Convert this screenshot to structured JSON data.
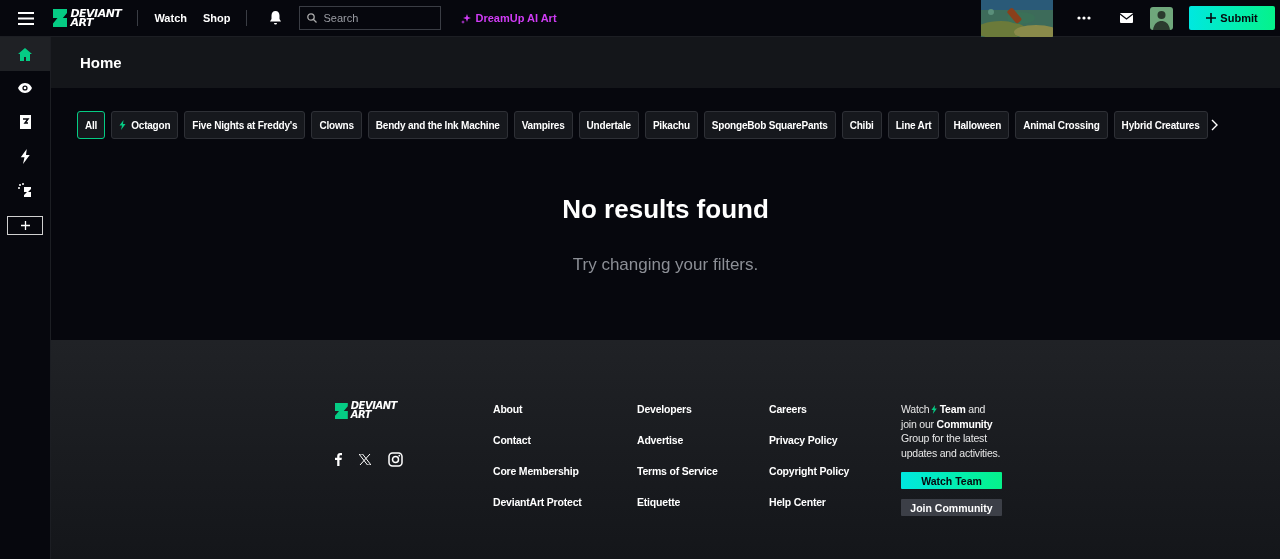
{
  "topbar": {
    "logo": [
      "DEVIANT",
      "ART"
    ],
    "nav": [
      "Watch",
      "Shop"
    ],
    "search": {
      "placeholder": "Search"
    },
    "dreamup": "DreamUp AI Art",
    "submit": "Submit"
  },
  "sidebar": {
    "items": [
      {
        "kind": "home",
        "selected": true
      },
      {
        "kind": "eye",
        "selected": false
      },
      {
        "kind": "bookmark",
        "selected": false
      },
      {
        "kind": "bolt",
        "selected": false
      },
      {
        "kind": "sparkle",
        "selected": false
      }
    ]
  },
  "page": {
    "title": "Home"
  },
  "tags": [
    {
      "label": "All",
      "selected": true
    },
    {
      "label": "Octagon",
      "selected": false,
      "kind": "bolt"
    },
    {
      "label": "Five Nights at Freddy's",
      "selected": false
    },
    {
      "label": "Clowns",
      "selected": false
    },
    {
      "label": "Bendy and the Ink Machine",
      "selected": false
    },
    {
      "label": "Vampires",
      "selected": false
    },
    {
      "label": "Undertale",
      "selected": false
    },
    {
      "label": "Pikachu",
      "selected": false
    },
    {
      "label": "SpongeBob SquarePants",
      "selected": false
    },
    {
      "label": "Chibi",
      "selected": false
    },
    {
      "label": "Line Art",
      "selected": false
    },
    {
      "label": "Halloween",
      "selected": false
    },
    {
      "label": "Animal Crossing",
      "selected": false
    },
    {
      "label": "Hybrid Creatures",
      "selected": false
    }
  ],
  "empty": {
    "title": "No results found",
    "subtitle": "Try changing your filters."
  },
  "footer": {
    "logo": [
      "DEVIANT",
      "ART"
    ],
    "columns": [
      [
        "About",
        "Contact",
        "Core Membership",
        "DeviantArt Protect"
      ],
      [
        "Developers",
        "Advertise",
        "Terms of Service",
        "Etiquette"
      ],
      [
        "Careers",
        "Privacy Policy",
        "Copyright Policy",
        "Help Center"
      ]
    ],
    "watch_word": "Watch",
    "team_line": "**Team** and",
    "blurb": "join our **Community** Group for the latest updates and activities.",
    "buttons": [
      {
        "label": "Watch Team",
        "kind": "primary"
      },
      {
        "label": "Join Community",
        "kind": "secondary"
      }
    ]
  }
}
